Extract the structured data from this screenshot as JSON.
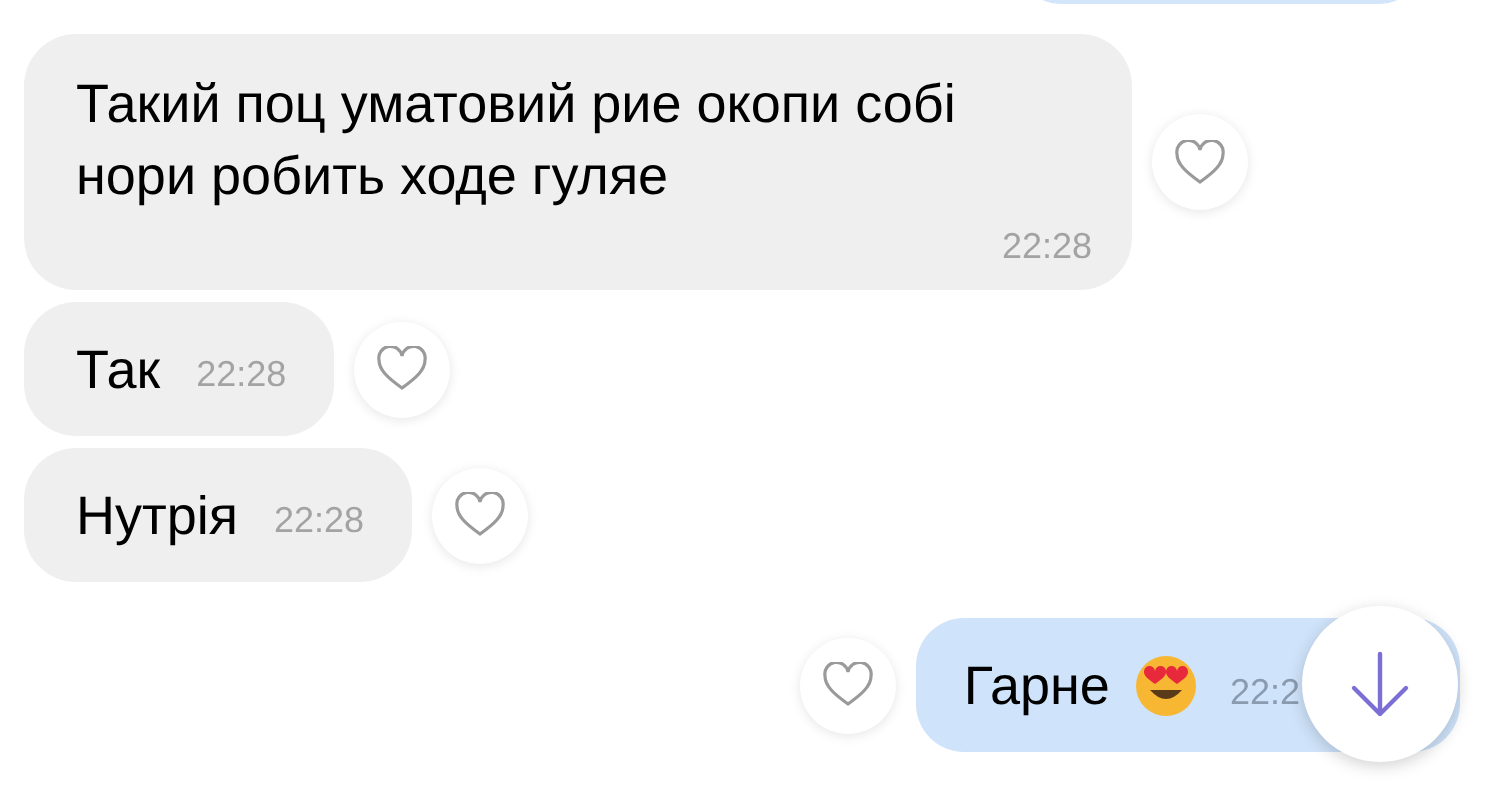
{
  "messages": [
    {
      "kind": "incoming",
      "text": "Такий поц уматовий рие окопи собі нори робить ходе гуляе",
      "time": "22:28",
      "liked": false,
      "has_emoji": false
    },
    {
      "kind": "incoming",
      "text": "Так",
      "time": "22:28",
      "liked": false,
      "has_emoji": false
    },
    {
      "kind": "incoming",
      "text": "Нутрія",
      "time": "22:28",
      "liked": false,
      "has_emoji": false
    },
    {
      "kind": "outgoing",
      "text": "Гарне",
      "time": "22:2",
      "liked": false,
      "has_emoji": true
    }
  ]
}
